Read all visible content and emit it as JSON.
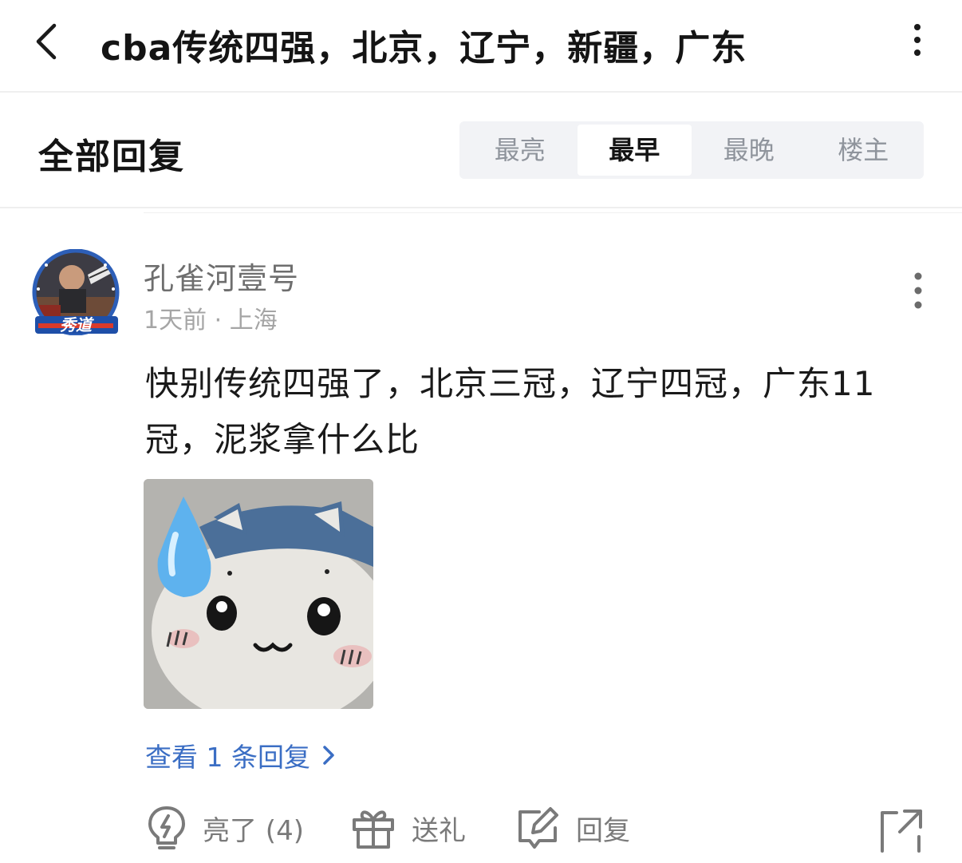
{
  "header": {
    "title": "cba传统四强，北京，辽宁，新疆，广东"
  },
  "replies_section": {
    "title": "全部回复",
    "sort_tabs": [
      {
        "label": "最亮",
        "active": false
      },
      {
        "label": "最早",
        "active": true
      },
      {
        "label": "最晚",
        "active": false
      },
      {
        "label": "楼主",
        "active": false
      }
    ]
  },
  "comment": {
    "username": "孔雀河壹号",
    "meta": "1天前 · 上海",
    "text": "快别传统四强了，北京三冠，辽宁四冠，广东11冠，泥浆拿什么比",
    "avatar_badge_text": "秀道",
    "view_replies": "查看 1 条回复",
    "actions": {
      "light_label": "亮了 (4)",
      "gift_label": "送礼",
      "reply_label": "回复"
    }
  },
  "colors": {
    "accent_link": "#3b6ec4",
    "muted_text": "#7a7a7a",
    "tab_bg": "#f2f3f6"
  },
  "icons": [
    "back-arrow-icon",
    "more-vertical-icon",
    "lightbulb-icon",
    "gift-icon",
    "edit-reply-icon",
    "share-icon",
    "chevron-right-icon"
  ]
}
